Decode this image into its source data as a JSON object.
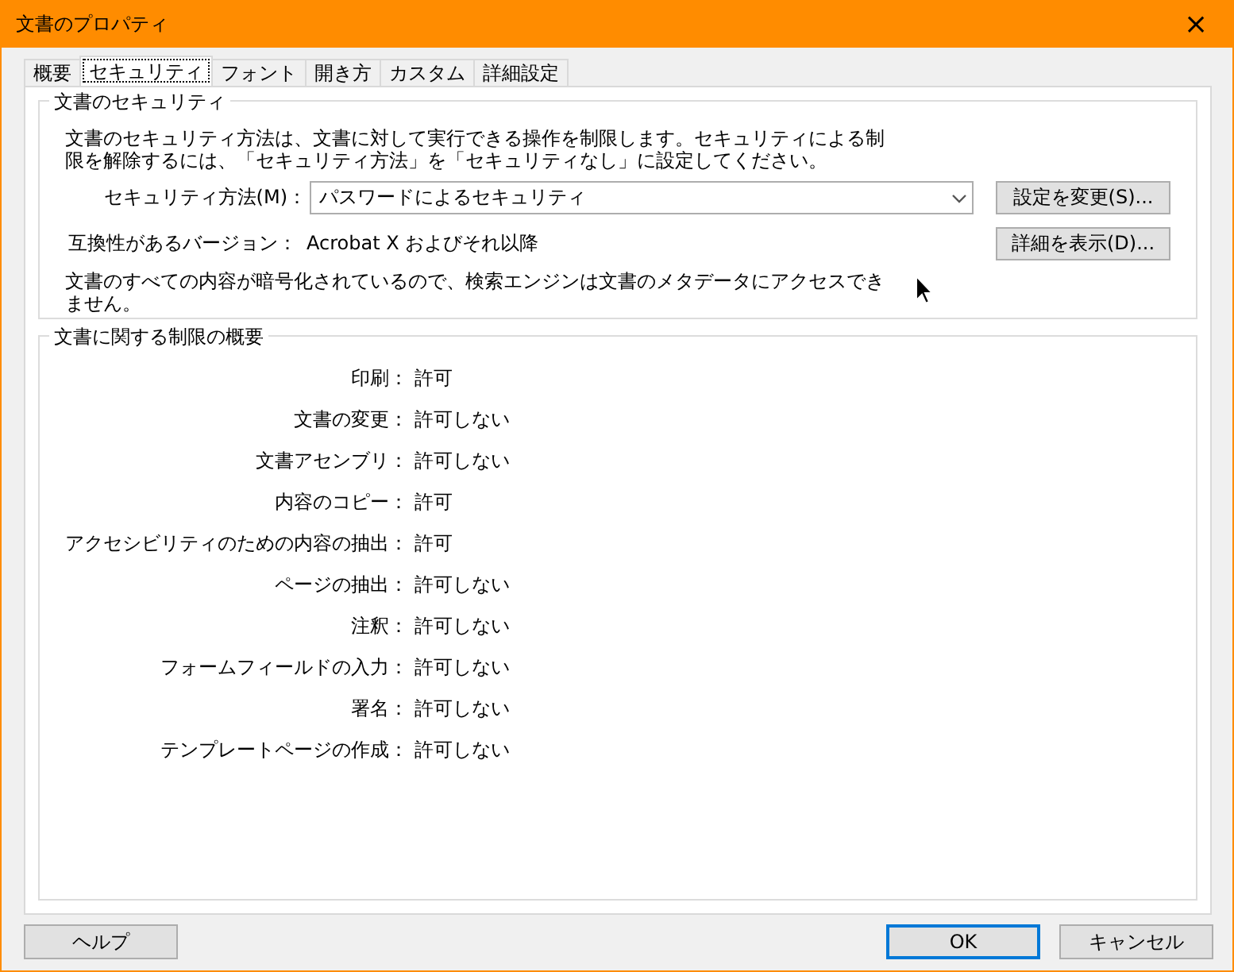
{
  "window": {
    "title": "文書のプロパティ",
    "close": "×"
  },
  "tabs": [
    {
      "label": "概要",
      "selected": false
    },
    {
      "label": "セキュリティ",
      "selected": true
    },
    {
      "label": "フォント",
      "selected": false
    },
    {
      "label": "開き方",
      "selected": false
    },
    {
      "label": "カスタム",
      "selected": false
    },
    {
      "label": "詳細設定",
      "selected": false
    }
  ],
  "security": {
    "title": "文書のセキュリティ",
    "description": "文書のセキュリティ方法は、文書に対して実行できる操作を制限します。セキュリティによる制限を解除するには、「セキュリティ方法」を「セキュリティなし」に設定してください。",
    "method_label": "セキュリティ方法(M)：",
    "method_value": "パスワードによるセキュリティ",
    "change_button": "設定を変更(S)...",
    "version_label": "互換性があるバージョン：",
    "version_value": "Acrobat X およびそれ以降",
    "details_button": "詳細を表示(D)...",
    "note": "文書のすべての内容が暗号化されているので、検索エンジンは文書のメタデータにアクセスできません。"
  },
  "restrictions": {
    "title": "文書に関する制限の概要",
    "rows": [
      {
        "label": "印刷：",
        "value": "許可"
      },
      {
        "label": "文書の変更：",
        "value": "許可しない"
      },
      {
        "label": "文書アセンブリ：",
        "value": "許可しない"
      },
      {
        "label": "内容のコピー：",
        "value": "許可"
      },
      {
        "label": "アクセシビリティのための内容の抽出：",
        "value": "許可"
      },
      {
        "label": "ページの抽出：",
        "value": "許可しない"
      },
      {
        "label": "注釈：",
        "value": "許可しない"
      },
      {
        "label": "フォームフィールドの入力：",
        "value": "許可しない"
      },
      {
        "label": "署名：",
        "value": "許可しない"
      },
      {
        "label": "テンプレートページの作成：",
        "value": "許可しない"
      }
    ]
  },
  "buttons": {
    "help": "ヘルプ",
    "ok": "OK",
    "cancel": "キャンセル"
  }
}
